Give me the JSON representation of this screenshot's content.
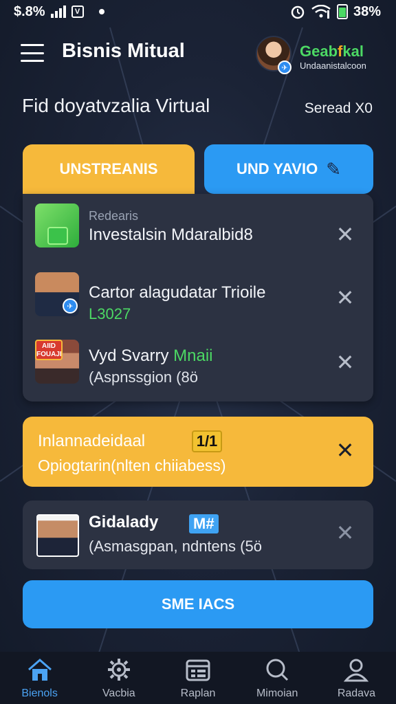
{
  "status_bar": {
    "left_text": "$.8%",
    "box_glyph": "V",
    "battery": "38%"
  },
  "header": {
    "title": "Bisnis Mitual",
    "user": {
      "name_green": "Geab",
      "name_orange": "f",
      "name_rest": "kal",
      "subtitle": "Undaanistalcoon"
    }
  },
  "section": {
    "title": "Fid doyatvzalia Virtual",
    "meta": "Seread X0"
  },
  "tabs": [
    {
      "label": "UNSTREANIS"
    },
    {
      "label": "UND YAVIO"
    }
  ],
  "list_items": [
    {
      "label_small": "Redearis",
      "title": "Investalsin Mdaralbid8",
      "sub": ""
    },
    {
      "label_small": "",
      "title": "Cartor alagudatar Trioile",
      "sub": "L3027"
    },
    {
      "label_small": "",
      "title_main": "Vyd Svarry",
      "title_accent": "Mnaii",
      "sub": "(Aspnssgion (8ö",
      "thumb_tag": "AIID FOUAJI"
    }
  ],
  "highlight_card": {
    "title": "Inlannadeidaal",
    "badge": "1/1",
    "sub": "Opiogtarin(nlten chiiabess)"
  },
  "contact_card": {
    "title": "Gidalady",
    "badge": "M#",
    "sub": "(Asmasgpan, ndntens (5ö"
  },
  "primary_button": {
    "label": "SME IACS"
  },
  "bottom_nav": [
    {
      "label": "Bienols",
      "icon": "home-icon"
    },
    {
      "label": "Vacbia",
      "icon": "gear-icon"
    },
    {
      "label": "Raplan",
      "icon": "calendar-icon"
    },
    {
      "label": "Mimoian",
      "icon": "search-icon"
    },
    {
      "label": "Radava",
      "icon": "profile-icon"
    }
  ],
  "colors": {
    "accent_blue": "#2b9af3",
    "accent_yellow": "#f6b93b",
    "success_green": "#4cd964",
    "background": "#1b2336"
  }
}
